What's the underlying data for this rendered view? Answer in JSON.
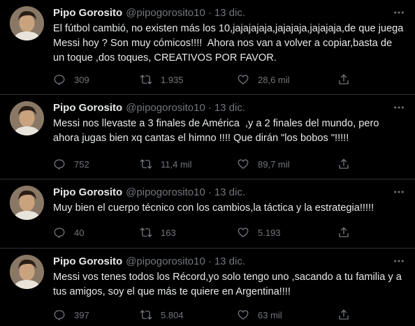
{
  "tweets": [
    {
      "name": "Pipo Gorosito",
      "handle": "@pipogorosito10",
      "separator": "·",
      "date": "13 dic.",
      "text": "El fútbol cambió, no existen más los 10,jajajajaja,jajajaja,jajajaja,de que juega Messi hoy ? Son muy cómicos!!!!  Ahora nos van a volver a copiar,basta de un toque ,dos toques, CREATIVOS POR FAVOR.",
      "replies": "309",
      "retweets": "1.935",
      "likes": "28,6 mil"
    },
    {
      "name": "Pipo Gorosito",
      "handle": "@pipogorosito10",
      "separator": "·",
      "date": "13 dic.",
      "text": "Messi nos llevaste a 3 finales de América  ,y a 2 finales del mundo, pero ahora jugas bien xq cantas el himno !!!! Que dirán \"los bobos \"!!!!!",
      "replies": "752",
      "retweets": "11,4 mil",
      "likes": "89,7 mil"
    },
    {
      "name": "Pipo Gorosito",
      "handle": "@pipogorosito10",
      "separator": "·",
      "date": "13 dic.",
      "text": "Muy bien el cuerpo técnico con los cambios,la táctica y la estrategia!!!!!",
      "replies": "40",
      "retweets": "163",
      "likes": "5.193"
    },
    {
      "name": "Pipo Gorosito",
      "handle": "@pipogorosito10",
      "separator": "·",
      "date": "13 dic.",
      "text": "Messi vos tenes todos los Récord,yo solo tengo uno ,sacando a tu familia y a tus amigos, soy el que más te quiere en Argentina!!!!",
      "replies": "397",
      "retweets": "5.804",
      "likes": "63 mil"
    }
  ],
  "icons": {
    "more": "more-dots-icon",
    "reply": "reply-bubble-icon",
    "retweet": "retweet-arrows-icon",
    "like": "heart-icon",
    "share": "share-upload-icon"
  },
  "colors": {
    "background": "#000000",
    "text": "#e7e9ea",
    "muted": "#71767b",
    "divider": "#2f3336"
  }
}
